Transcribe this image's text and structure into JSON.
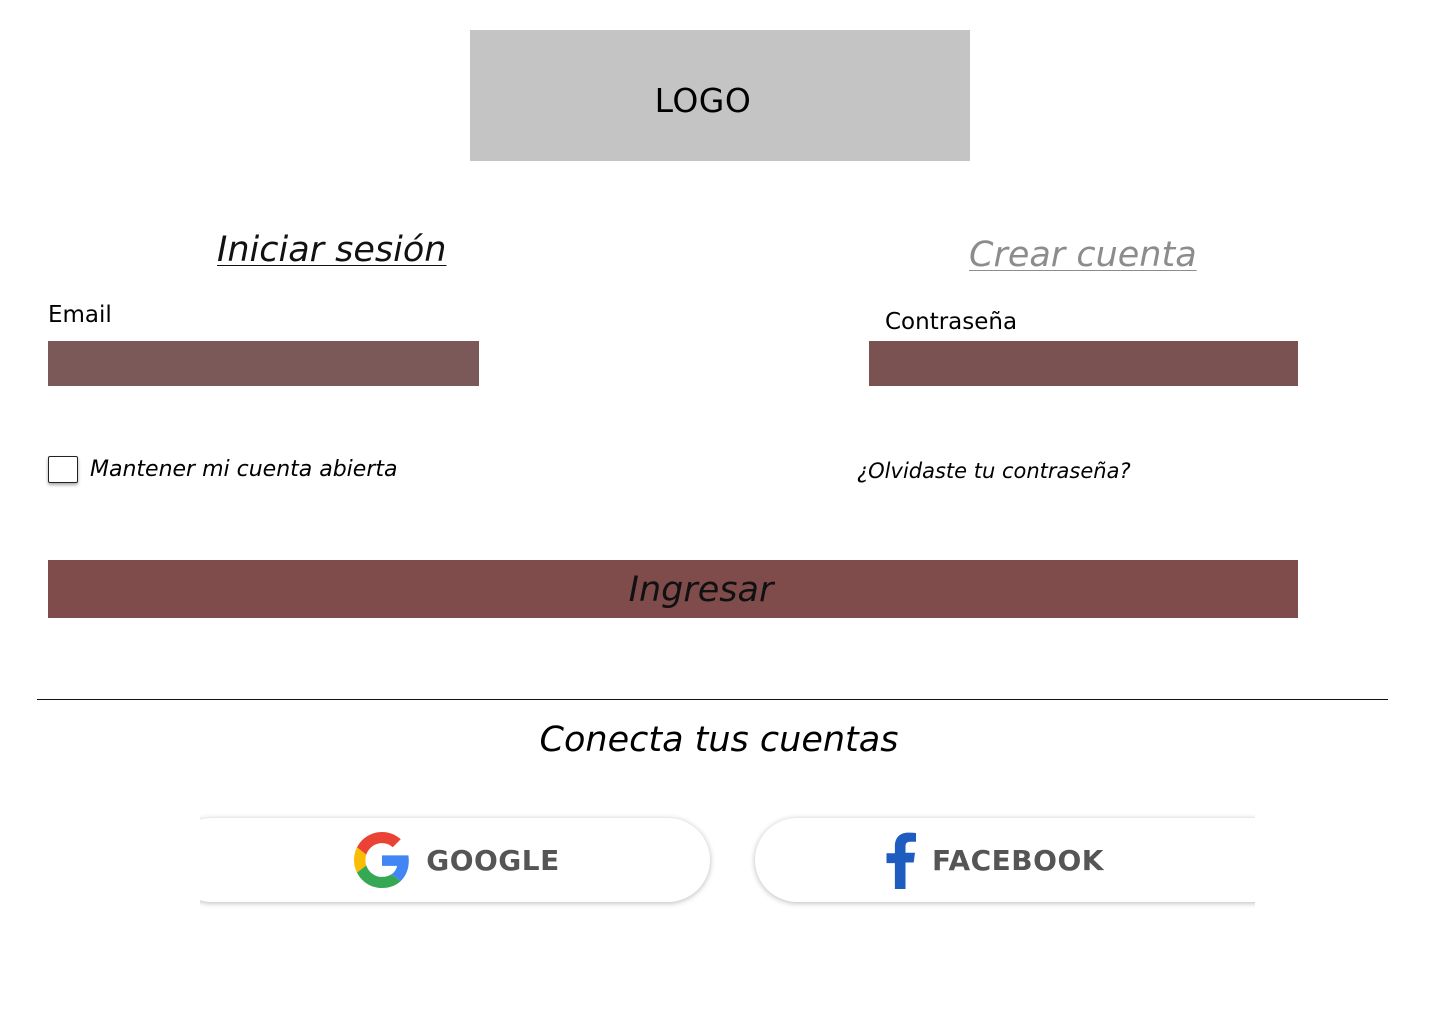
{
  "logo": {
    "text": "LOGO"
  },
  "tabs": {
    "login": "Iniciar sesión",
    "signup": "Crear cuenta"
  },
  "form": {
    "email_label": "Email",
    "email_value": "",
    "password_label": "Contraseña",
    "password_value": "",
    "remember_label": "Mantener mi cuenta abierta",
    "remember_checked": false,
    "forgot_label": "¿Olvidaste tu contraseña?",
    "submit_label": "Ingresar"
  },
  "social": {
    "title": "Conecta tus cuentas",
    "google_label": "GOOGLE",
    "facebook_label": "FACEBOOK"
  },
  "colors": {
    "logo_bg": "#c4c4c4",
    "input_bg": "#7a5252",
    "submit_bg": "#7f4b4b",
    "inactive_tab": "#8c8c8c",
    "google_blue": "#4285F4",
    "google_red": "#EA4335",
    "google_yellow": "#FBBC05",
    "google_green": "#34A853",
    "facebook_blue": "#1877F2"
  },
  "icons": {
    "google": "google-g-icon",
    "facebook": "facebook-f-icon"
  }
}
